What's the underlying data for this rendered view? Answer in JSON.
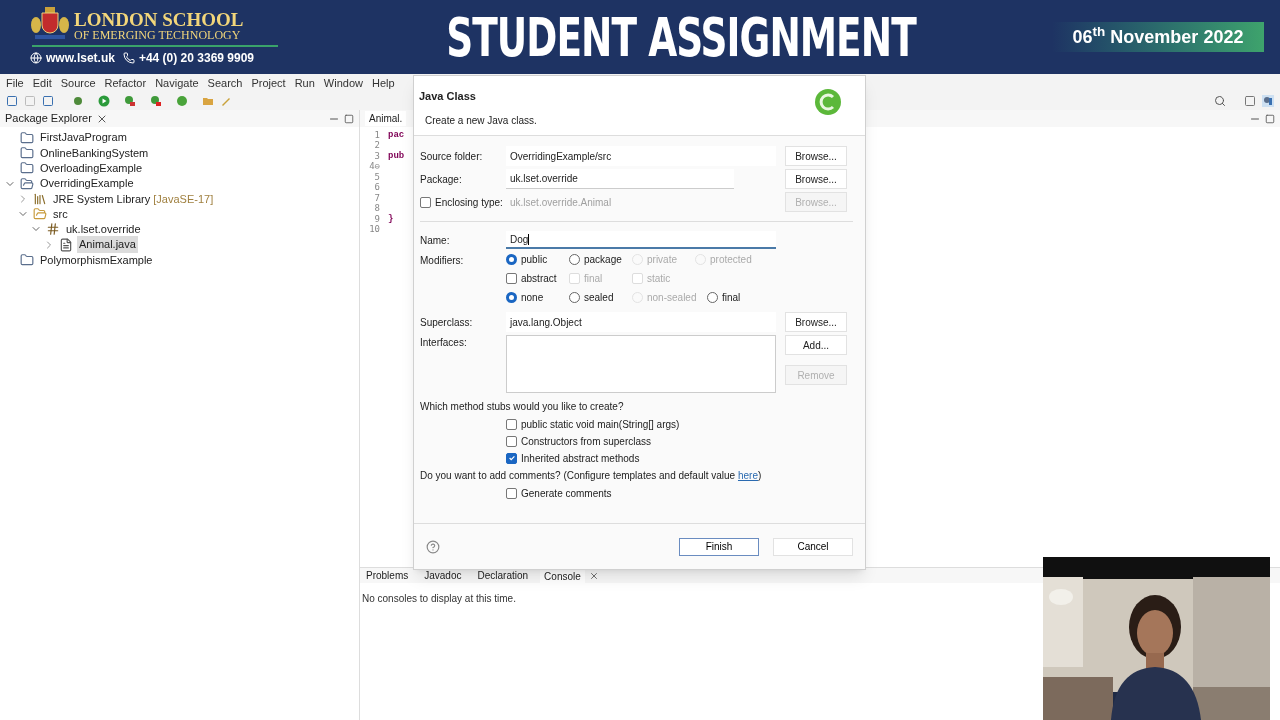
{
  "banner": {
    "school_name": "LONDON SCHOOL",
    "school_subtitle": "OF EMERGING TECHNOLOGY",
    "website": "www.lset.uk",
    "phone": "+44 (0) 20 3369 9909",
    "title": "STUDENT ASSIGNMENT",
    "date": "06$^{th}$ November 2022"
  },
  "menu": [
    "File",
    "Edit",
    "Source",
    "Refactor",
    "Navigate",
    "Search",
    "Project",
    "Run",
    "Window",
    "Help"
  ],
  "package_explorer": {
    "title": "Package Explorer",
    "tree": [
      {
        "label": "FirstJavaProgram",
        "kind": "project"
      },
      {
        "label": "OnlineBankingSystem",
        "kind": "project"
      },
      {
        "label": "OverloadingExample",
        "kind": "project"
      },
      {
        "label": "OverridingExample",
        "kind": "open-project",
        "expanded": true,
        "children": [
          {
            "label": "JRE System Library",
            "decoration": "[JavaSE-17]",
            "kind": "library",
            "expanded": false
          },
          {
            "label": "src",
            "kind": "source",
            "expanded": true,
            "children": [
              {
                "label": "uk.lset.override",
                "kind": "package",
                "expanded": true,
                "children": [
                  {
                    "label": "Animal.java",
                    "kind": "file",
                    "expanded": false,
                    "selected": true
                  }
                ]
              }
            ]
          }
        ]
      },
      {
        "label": "PolymorphismExample",
        "kind": "project"
      }
    ]
  },
  "editor": {
    "tab": "Animal.",
    "lines": [
      {
        "number": "1",
        "code": "pac"
      },
      {
        "number": "2"
      },
      {
        "number": "3",
        "code": "pub"
      },
      {
        "number": "4⊖"
      },
      {
        "number": "5"
      },
      {
        "number": "6"
      },
      {
        "number": "7"
      },
      {
        "number": "8"
      },
      {
        "number": "9",
        "code": "}"
      },
      {
        "number": "10"
      }
    ]
  },
  "bottom_panel": {
    "tabs": [
      {
        "label": "Problems",
        "selected": false
      },
      {
        "label": "Javadoc",
        "selected": false
      },
      {
        "label": "Declaration",
        "selected": false
      },
      {
        "label": "Console",
        "selected": true
      }
    ],
    "message": "No consoles to display at this time."
  },
  "dialog": {
    "title": "Java Class",
    "subtitle": "Create a new Java class.",
    "source_folder": {
      "label": "Source folder:",
      "value": "OverridingExample/src",
      "button": "Browse..."
    },
    "package": {
      "label": "Package:",
      "value": "uk.lset.override",
      "button": "Browse..."
    },
    "enclosing_type": {
      "label": "Enclosing type:",
      "checked": false,
      "value": "uk.lset.override.Animal",
      "button": "Browse...",
      "disabled": true
    },
    "name": {
      "label": "Name:",
      "value": "Dog"
    },
    "modifiers": {
      "label": "Modifiers:",
      "rows": [
        [
          {
            "label": "public",
            "kind": "radio",
            "selected": true,
            "disabled": false
          },
          {
            "label": "package",
            "kind": "radio",
            "selected": false,
            "disabled": false
          },
          {
            "label": "private",
            "kind": "radio",
            "selected": false,
            "disabled": true
          },
          {
            "label": "protected",
            "kind": "radio",
            "selected": false,
            "disabled": true
          }
        ],
        [
          {
            "label": "abstract",
            "kind": "checkbox",
            "selected": false,
            "disabled": false
          },
          {
            "label": "final",
            "kind": "checkbox",
            "selected": false,
            "disabled": true
          },
          {
            "label": "static",
            "kind": "checkbox",
            "selected": false,
            "disabled": true
          }
        ],
        [
          {
            "label": "none",
            "kind": "radio",
            "selected": true,
            "disabled": false
          },
          {
            "label": "sealed",
            "kind": "radio",
            "selected": false,
            "disabled": false
          },
          {
            "label": "non-sealed",
            "kind": "radio",
            "selected": false,
            "disabled": true
          },
          {
            "label": "final",
            "kind": "radio",
            "selected": false,
            "disabled": false
          }
        ]
      ]
    },
    "superclass": {
      "label": "Superclass:",
      "value": "java.lang.Object",
      "button": "Browse..."
    },
    "interfaces": {
      "label": "Interfaces:",
      "buttons": [
        {
          "label": "Add...",
          "disabled": false
        },
        {
          "label": "Remove",
          "disabled": true
        }
      ]
    },
    "stubs": {
      "question": "Which method stubs would you like to create?",
      "options": [
        {
          "label": "public static void main(String[] args)",
          "checked": false
        },
        {
          "label": "Constructors from superclass",
          "checked": false
        },
        {
          "label": "Inherited abstract methods",
          "checked": true
        }
      ]
    },
    "comments": {
      "question": "Do you want to add comments? (Configure templates and default value ",
      "link": "here",
      "question_end": ")",
      "options": [
        {
          "label": "Generate comments",
          "checked": false
        }
      ]
    },
    "buttons": [
      {
        "label": "Finish",
        "default": true
      },
      {
        "label": "Cancel",
        "default": false
      }
    ]
  }
}
